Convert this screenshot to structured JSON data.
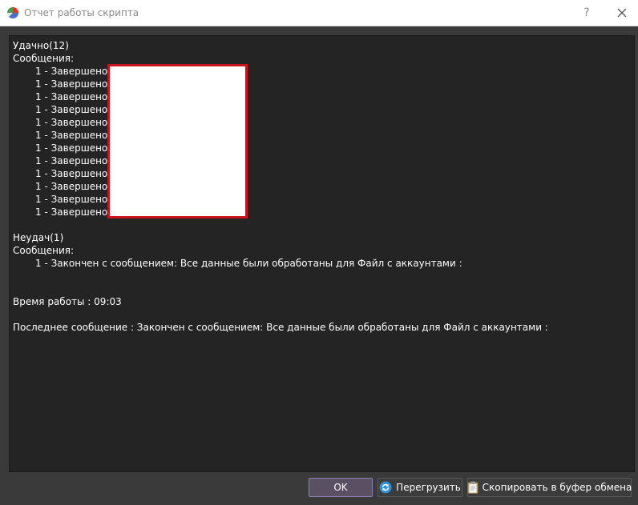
{
  "window": {
    "title": "Отчет работы скрипта",
    "help_label": "?",
    "close_label": "×"
  },
  "report": {
    "success_header": "Удачно(12)",
    "success_messages_label": "Сообщения:",
    "success_items": [
      "1 - Завершено",
      "1 - Завершено",
      "1 - Завершено",
      "1 - Завершено",
      "1 - Завершено",
      "1 - Завершено",
      "1 - Завершено",
      "1 - Завершено",
      "1 - Завершено",
      "1 - Завершено",
      "1 - Завершено",
      "1 - Завершено"
    ],
    "fail_header": "Неудач(1)",
    "fail_messages_label": "Сообщения:",
    "fail_items": [
      "1 - Закончен с сообщением: Все данные были обработаны для Файл с аккаунтами :"
    ],
    "runtime": "Время работы : 09:03",
    "last_message": "Последнее сообщение : Закончен с сообщением: Все данные были обработаны для Файл с аккаунтами :"
  },
  "buttons": {
    "ok_label": "OK",
    "reload_label": "Перегрузить",
    "copy_label": "Скопировать в буфер обмена"
  },
  "colors": {
    "redaction_border": "#c8141c",
    "ok_border": "#8f82b0"
  },
  "icons": {
    "app": "pie-chart-icon",
    "reload": "refresh-icon",
    "copy": "clipboard-icon"
  }
}
